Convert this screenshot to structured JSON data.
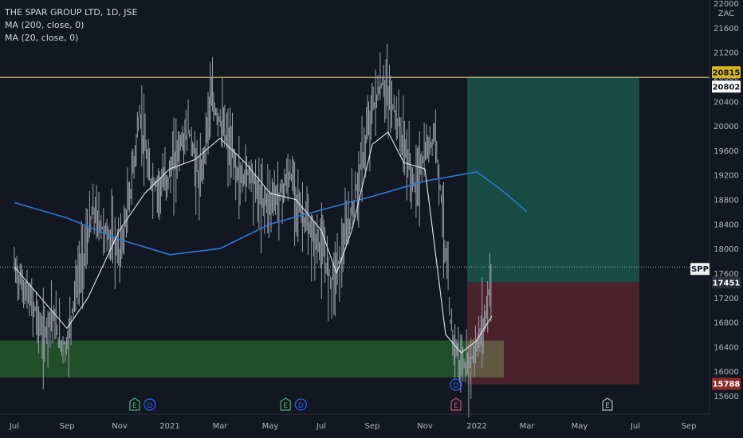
{
  "legend": {
    "symbol": "THE SPAR GROUP LTD, 1D, JSE",
    "ma200": "MA (200, close, 0)",
    "ma20": "MA (20, close, 0)"
  },
  "currency": "ZAC",
  "colors": {
    "background": "#131722",
    "price_bars": "#9aa0aa",
    "ma200": "#2a7ad2",
    "ma20": "#e8e8e8",
    "resistance_line": "#d4c36a",
    "support_zone": "#2e7d32",
    "target_zone": "#1b5e50",
    "stop_zone": "#5a2530",
    "last_price_line": "#b2b5be",
    "label_yellow": "#d4b71e",
    "label_red": "#8b2b2b",
    "label_gray": "#2a2e39",
    "earnings_marker": "#c25a6e",
    "earnings_marker_past": "#4caf7a",
    "dividend_marker": "#2962ff"
  },
  "chart_data": {
    "type": "candlestick",
    "title": "THE SPAR GROUP LTD, 1D, JSE",
    "ylabel": "ZAC",
    "ylim": [
      15400,
      22000
    ],
    "y_ticks": [
      15600,
      16000,
      16400,
      16800,
      17200,
      17600,
      18000,
      18400,
      18800,
      19200,
      19600,
      20000,
      20400,
      20800,
      21200,
      21600,
      22000
    ],
    "x_ticks": [
      "Jul",
      "Sep",
      "Nov",
      "2021",
      "Mar",
      "May",
      "Jul",
      "Sep",
      "Nov",
      "2022",
      "Mar",
      "May",
      "Jul",
      "Sep"
    ],
    "price_labels": [
      {
        "text": "20815",
        "style": "yellow"
      },
      {
        "text": "20802",
        "style": "dark"
      },
      {
        "text": "SPP",
        "style": "gray"
      },
      {
        "text": "17451",
        "style": "gray"
      },
      {
        "text": "15788",
        "style": "red"
      }
    ],
    "horizontal_line": 20815,
    "last_price": 17700,
    "support_zone": [
      15900,
      16500
    ],
    "target_zone": [
      17451,
      20802
    ],
    "stop_zone": [
      15788,
      17451
    ],
    "series": [
      {
        "name": "MA (200, close, 0)",
        "values": [
          [
            0,
            18750
          ],
          [
            1,
            18500
          ],
          [
            2,
            18150
          ],
          [
            3,
            17900
          ],
          [
            4,
            18000
          ],
          [
            5,
            18400
          ],
          [
            6,
            18630
          ],
          [
            7,
            18850
          ],
          [
            8,
            19100
          ],
          [
            9,
            19250
          ],
          [
            9.5,
            18950
          ],
          [
            10,
            18600
          ]
        ]
      },
      {
        "name": "MA (20, close, 0)",
        "values": [
          [
            0,
            17700
          ],
          [
            0.5,
            17200
          ],
          [
            1,
            16700
          ],
          [
            1.4,
            17200
          ],
          [
            2,
            18300
          ],
          [
            2.5,
            18900
          ],
          [
            3,
            19300
          ],
          [
            3.5,
            19450
          ],
          [
            4,
            19800
          ],
          [
            4.5,
            19400
          ],
          [
            5,
            18900
          ],
          [
            5.5,
            18800
          ],
          [
            6,
            18300
          ],
          [
            6.3,
            17600
          ],
          [
            6.6,
            18300
          ],
          [
            7,
            19700
          ],
          [
            7.3,
            19900
          ],
          [
            7.6,
            19400
          ],
          [
            8,
            19300
          ],
          [
            8.4,
            16600
          ],
          [
            8.7,
            16300
          ],
          [
            9,
            16500
          ],
          [
            9.3,
            16900
          ]
        ]
      },
      {
        "name": "price",
        "values": [
          [
            0,
            17700
          ],
          [
            0.2,
            17300
          ],
          [
            0.4,
            17000
          ],
          [
            0.55,
            16500
          ],
          [
            0.7,
            17000
          ],
          [
            0.85,
            16500
          ],
          [
            1,
            16400
          ],
          [
            1.15,
            17300
          ],
          [
            1.3,
            17800
          ],
          [
            1.5,
            18600
          ],
          [
            1.7,
            18300
          ],
          [
            1.9,
            18100
          ],
          [
            2,
            17900
          ],
          [
            2.2,
            18800
          ],
          [
            2.4,
            20200
          ],
          [
            2.6,
            19100
          ],
          [
            2.8,
            19000
          ],
          [
            3,
            19200
          ],
          [
            3.2,
            19700
          ],
          [
            3.4,
            19900
          ],
          [
            3.6,
            19000
          ],
          [
            3.8,
            20400
          ],
          [
            4,
            20100
          ],
          [
            4.2,
            19600
          ],
          [
            4.4,
            19100
          ],
          [
            4.6,
            19300
          ],
          [
            4.8,
            18800
          ],
          [
            5,
            18800
          ],
          [
            5.2,
            18900
          ],
          [
            5.4,
            19200
          ],
          [
            5.6,
            18600
          ],
          [
            5.8,
            18200
          ],
          [
            6,
            18000
          ],
          [
            6.2,
            17500
          ],
          [
            6.4,
            17900
          ],
          [
            6.6,
            18600
          ],
          [
            6.8,
            19400
          ],
          [
            7,
            20300
          ],
          [
            7.2,
            20700
          ],
          [
            7.4,
            20300
          ],
          [
            7.6,
            19700
          ],
          [
            7.8,
            19000
          ],
          [
            8,
            19500
          ],
          [
            8.2,
            19900
          ],
          [
            8.35,
            18500
          ],
          [
            8.5,
            16700
          ],
          [
            8.65,
            16200
          ],
          [
            8.8,
            16000
          ],
          [
            9,
            16400
          ],
          [
            9.2,
            17000
          ],
          [
            9.3,
            17700
          ]
        ]
      }
    ],
    "events": [
      {
        "type": "E",
        "month": 2.3,
        "kind": "past"
      },
      {
        "type": "D",
        "month": 2.6,
        "kind": "dividend"
      },
      {
        "type": "E",
        "month": 5.3,
        "kind": "past"
      },
      {
        "type": "D",
        "month": 5.6,
        "kind": "dividend"
      },
      {
        "type": "D",
        "month": 8.6,
        "kind": "dividend"
      },
      {
        "type": "E",
        "month": 8.6,
        "kind": "upcoming"
      },
      {
        "type": "E",
        "month": 11.5,
        "kind": "future"
      }
    ]
  }
}
